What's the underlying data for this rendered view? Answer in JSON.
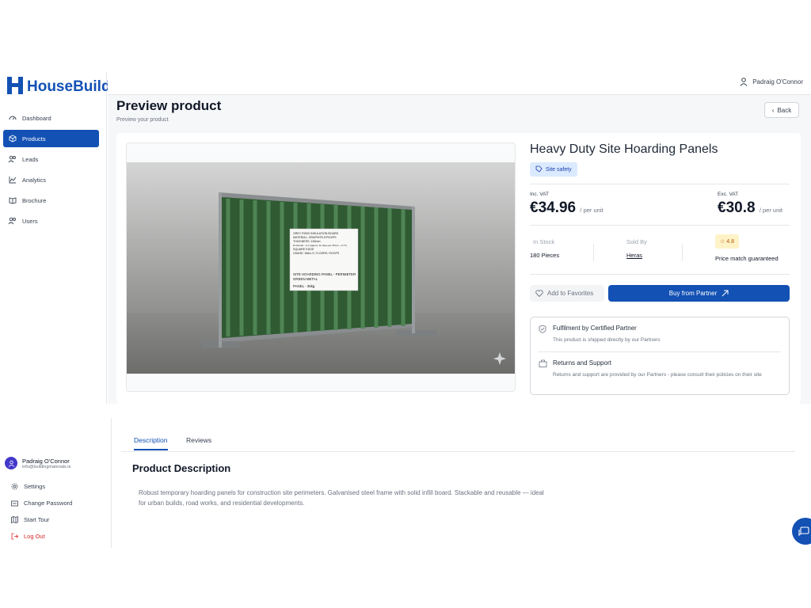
{
  "brand": {
    "name": "HouseBuild",
    "color": "#1351b4"
  },
  "sidebar": {
    "items": [
      {
        "label": "Dashboard",
        "icon": "gauge-icon"
      },
      {
        "label": "Products",
        "icon": "box-icon",
        "active": true
      },
      {
        "label": "Leads",
        "icon": "users-icon"
      },
      {
        "label": "Analytics",
        "icon": "chart-line-icon"
      },
      {
        "label": "Brochure",
        "icon": "book-icon"
      },
      {
        "label": "Users",
        "icon": "users-icon"
      }
    ],
    "user": {
      "name": "Padraig O'Connor",
      "email": "info@buildingmaterials.ie"
    },
    "footer": [
      {
        "label": "Settings",
        "icon": "gear-icon"
      },
      {
        "label": "Change Password",
        "icon": "card-icon"
      },
      {
        "label": "Start Tour",
        "icon": "map-icon"
      },
      {
        "label": "Log Out",
        "icon": "logout-icon"
      }
    ]
  },
  "header": {
    "user_name": "Padraig O'Connor"
  },
  "page": {
    "title": "Preview product",
    "subtitle": "Preview your product",
    "back_label": "Back"
  },
  "product": {
    "name": "Heavy Duty Site Hoarding Panels",
    "category": "Site safety",
    "inc_vat_label": "Inc. VAT",
    "inc_vat_price": "€34.96",
    "exc_vat_label": "Exc. VAT",
    "exc_vat_price": "€30.8",
    "per_unit": "/ per unit",
    "in_stock_label": "In Stock",
    "in_stock_value": "180 Pieces",
    "sold_by_label": "Sold By",
    "sold_by_value": "Heras",
    "rating": "4.8",
    "price_match": "Price match guaranteed",
    "favorites_label": "Add to Favorites",
    "buy_label": "Buy from Partner",
    "fulfilment_title": "Fulfilment by Certified Partner",
    "fulfilment_desc": "This product is shipped directly by our Partners",
    "returns_title": "Returns and Support",
    "returns_desc": "Returns and support are provided by our Partners - please consult their policies on their site",
    "image_label": {
      "line1": "GREY RIGID INSULATION BOARD",
      "line2": "MATERIAL: GRAPHITE-EPS/XPS",
      "line3": "THICKNESS: 100mm",
      "line4": "R-VALUE: ~3.1 (approx. R-value per 25mm: ~0.77)",
      "line5": "SQUARE EDGE",
      "line6": "USAGE: WALLS, FLOORS, ROOFS",
      "line7": "SITE HOARDING PANEL - PERIMETER",
      "line8": "GREEN METAL",
      "line9": "PANEL - 35kg"
    }
  },
  "tabs": [
    {
      "label": "Description",
      "active": true
    },
    {
      "label": "Reviews"
    }
  ],
  "description": {
    "title": "Product Description",
    "body": "Robust temporary hoarding panels for construction site perimeters. Galvanised steel frame with solid infill board. Stackable and reusable — ideal for urban builds, road works, and residential developments."
  }
}
